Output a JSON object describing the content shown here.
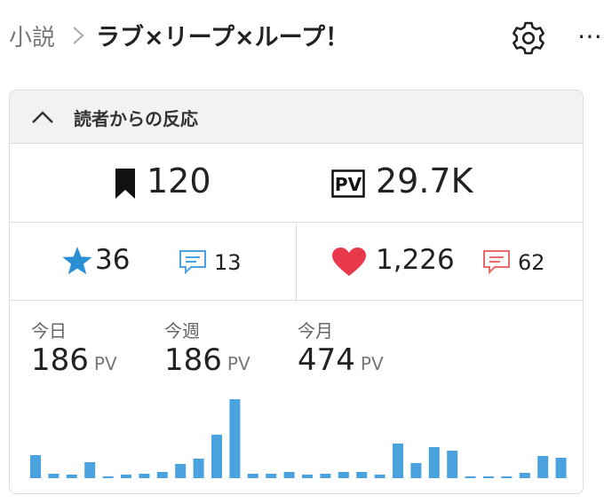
{
  "breadcrumb": {
    "root": "小説",
    "title": "ラブ×リープ×ループ！"
  },
  "icons": {
    "separator": "chevron-right-icon",
    "settings": "gear-icon",
    "more": "more-horizontal-icon"
  },
  "panel": {
    "title": "読者からの反応",
    "bookmarks": "120",
    "pv_total": "29.7K",
    "pv_badge": "PV",
    "stars": "36",
    "star_comments": "13",
    "hearts": "1,226",
    "heart_comments": "62"
  },
  "stats": {
    "today_label": "今日",
    "today_value": "186",
    "week_label": "今週",
    "week_value": "186",
    "month_label": "今月",
    "month_value": "474",
    "unit": "PV"
  },
  "colors": {
    "accent_blue": "#2b8fd6",
    "heart_red": "#e8384b",
    "bar_blue": "#4aa3df",
    "comment_red": "#e86a6a"
  },
  "chart_data": {
    "type": "bar",
    "values": [
      26,
      5,
      4,
      18,
      2,
      4,
      5,
      7,
      16,
      22,
      49,
      89,
      5,
      5,
      7,
      4,
      5,
      7,
      7,
      4,
      39,
      17,
      35,
      31,
      2,
      2,
      2,
      6,
      25,
      23
    ],
    "ylim": [
      0,
      92
    ]
  }
}
